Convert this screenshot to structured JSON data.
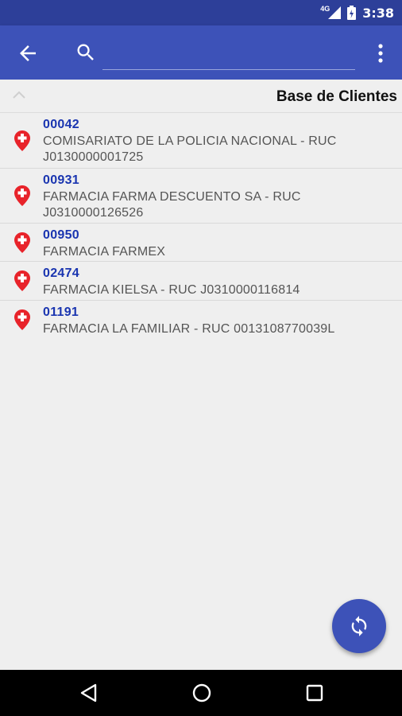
{
  "status_bar": {
    "network": "4G",
    "time": "3:38"
  },
  "toolbar": {
    "search_value": "",
    "search_placeholder": ""
  },
  "section": {
    "title": "Base de Clientes"
  },
  "clients": [
    {
      "code": "00042",
      "name_line1": "COMISARIATO DE LA POLICIA NACIONAL - RUC",
      "name_line2": "J0130000001725"
    },
    {
      "code": "00931",
      "name_line1": "FARMACIA FARMA DESCUENTO SA - RUC",
      "name_line2": "J0310000126526"
    },
    {
      "code": "00950",
      "name_line1": "FARMACIA FARMEX",
      "name_line2": ""
    },
    {
      "code": "02474",
      "name_line1": "FARMACIA KIELSA - RUC J0310000116814",
      "name_line2": ""
    },
    {
      "code": "01191",
      "name_line1": "FARMACIA LA FAMILIAR - RUC 0013108770039L",
      "name_line2": ""
    }
  ],
  "icons": {
    "back": "arrow-back-icon",
    "search": "search-icon",
    "more": "more-vert-icon",
    "collapse": "chevron-up-icon",
    "client_pin": "pharmacy-pin-icon",
    "fab": "sync-icon",
    "nav_back": "triangle-back-icon",
    "nav_home": "circle-home-icon",
    "nav_recents": "square-recents-icon"
  },
  "colors": {
    "status_bar": "#2d3f99",
    "primary": "#3d52b8",
    "client_code": "#1a35b0",
    "pin": "#e8232a",
    "background": "#efefef"
  }
}
